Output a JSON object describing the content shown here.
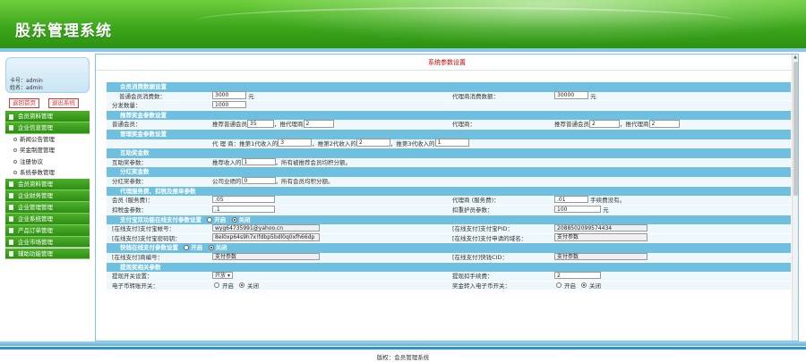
{
  "header": {
    "title": "股东管理系统"
  },
  "user": {
    "card_line": "卡号：admin",
    "name_line": "姓名：admin"
  },
  "left_buttons": {
    "home": "返回首页",
    "logout": "退出系统"
  },
  "menu": {
    "items": [
      {
        "label": "会员资料管理"
      },
      {
        "label": "企业信息管理"
      }
    ],
    "sub_items": [
      {
        "label": "新闻公告管理"
      },
      {
        "label": "奖金制度管理"
      },
      {
        "label": "注册协议"
      },
      {
        "label": "系统参数管理"
      }
    ],
    "items_after": [
      {
        "label": "会员资料管理"
      },
      {
        "label": "企业财务管理"
      },
      {
        "label": "企业管理管理"
      },
      {
        "label": "企业系统管理"
      },
      {
        "label": "产品订单管理"
      },
      {
        "label": "企业市场管理"
      },
      {
        "label": "辅助功能管理"
      }
    ]
  },
  "main": {
    "title": "系统参数设置"
  },
  "form": {
    "sec1": "会员消费数据设置",
    "r1": {
      "l1": "普通会员消费数：",
      "v1": "3000",
      "u1": "元",
      "l2": "代理商消费数额：",
      "v2": "30000",
      "u2": "元"
    },
    "r2": {
      "l1": "分发数量：",
      "v1": "1000"
    },
    "sec2": "推荐奖金参数设置",
    "r3": {
      "l1": "普通会员：",
      "t1": "推荐普通会员",
      "v1": "35",
      "t2": "，推代理商",
      "v2": "2",
      "l2": "代理商：",
      "t3": "推荐普通会员",
      "v3": "2",
      "t4": "，推代理商",
      "v4": "2"
    },
    "sec3": "管理奖金参数设置",
    "r4": {
      "t1": "代 理 商：推第1代收入的",
      "v1": "3",
      "t2": "，推第2代收入的",
      "v2": "2",
      "t3": "，推第3代收入的",
      "v3": "1"
    },
    "sec4": "互助奖金数",
    "r5": {
      "l1": "互助奖参数：",
      "t1": "推荐收入的",
      "v1": "1",
      "t2": "，所有被推荐会员均积分额。"
    },
    "sec5": "分红奖金数",
    "r6": {
      "l1": "分红奖参数：",
      "t1": "公司业绩的",
      "v1": "0",
      "t2": "，所有会员均积分额。"
    },
    "sec6": "代理服务费、扣税及报单参数",
    "r7": {
      "l1": "会员 (服务费)：",
      "v1": ".05",
      "l2": "代理商 (服务费)：",
      "v2": ".01",
      "u2": "手续费没有。"
    },
    "r8": {
      "l1": "扣税金参数：",
      "v1": ".1",
      "l2": "扣重护员参数：",
      "v2": "100",
      "u2": "元"
    },
    "sec7": "支付宝双功能在线支付参数设置",
    "sec7_on": "开启",
    "sec7_off": "关闭",
    "r9": {
      "l1": "[在线支付]支付宝帐号：",
      "v1": "wyg64735991@yahoo.cn",
      "l2": "[在线支付]支付宝PID：",
      "v2": "2088502099574434"
    },
    "r10": {
      "l1": "[在线支付]支付宝密码钥：",
      "v1": "8el0xp64s9h7x!fdbp5bdl0q0xfh66dp",
      "l2": "[在线支付]支付申请的域名：",
      "v2": "支付参数"
    },
    "sec8": "快钱在线支付参数设置",
    "sec8_on": "开启",
    "sec8_off": "关闭",
    "r11": {
      "l1": "[在线支付]商编号：",
      "v1": "支付参数",
      "l2": "[在线支付]快钱CID：",
      "v2": "支付参数"
    },
    "sec9": "提现奖相关参数",
    "r12": {
      "l1": "提现开关设置：",
      "v1": "开放",
      "l2": "提现扣手续费：",
      "v2": "2"
    },
    "r13": {
      "l1": "电子币转账开关：",
      "on": "开启",
      "off": "关闭",
      "l2": "奖金转入电子币开关：",
      "on2": "开启",
      "off2": "关闭"
    }
  },
  "footer": {
    "text": "版权：会员管理系统"
  },
  "colors": {
    "header_green": "#3aa41a",
    "section_blue": "#6fc0e0",
    "row_bg": "#eef8fc",
    "title_red": "#cc0000"
  }
}
